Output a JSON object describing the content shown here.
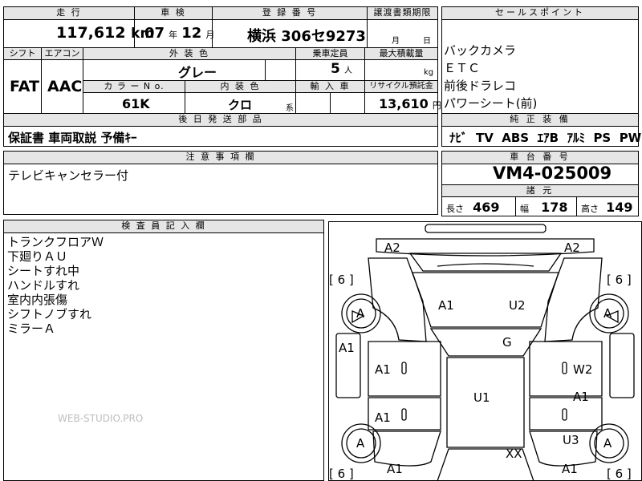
{
  "top": {
    "headers": {
      "mileage": "走 行",
      "inspection": "車 検",
      "registration": "登 録 番 号",
      "transfer": "譲渡書類期限",
      "shift": "シフト",
      "ac": "エアコン",
      "exterior": "外 装 色",
      "capacity": "乗車定員",
      "max_load": "最大積載量",
      "color_no": "カ ラ ー N o.",
      "interior": "内 装 色",
      "import": "輸 入 車",
      "recycle": "リサイクル預託金"
    },
    "mileage_value": "117,612",
    "mileage_unit": "km",
    "inspection_year": "07",
    "year_unit": "年",
    "inspection_month": "12",
    "month_unit": "月",
    "registration_value": "横浜 306セ9273",
    "transfer_month_unit": "月",
    "transfer_day_unit": "日",
    "shift_value": "FAT",
    "ac_value": "AAC",
    "exterior_value": "グレー",
    "capacity_value": "5",
    "capacity_unit": "人",
    "load_unit": "kg",
    "color_no_value": "61K",
    "interior_value": "クロ",
    "interior_suffix": "系",
    "recycle_value": "13,610",
    "recycle_unit": "円"
  },
  "sales_points": {
    "header": "セールスポイント",
    "items": [
      "バックカメラ",
      "ＥＴＣ",
      "前後ドラレコ",
      "パワーシート(前)"
    ]
  },
  "accessories": {
    "header": "後 日 発 送 部 品",
    "value": "保証書 車両取説 予備ｷｰ"
  },
  "genuine": {
    "header": "純 正 装 備",
    "items": [
      "ﾅﾋﾞ",
      "TV",
      "ABS",
      "ｴｱB",
      "ｱﾙﾐ",
      "PS",
      "PW"
    ]
  },
  "notes": {
    "header": "注 意 事 項 欄",
    "value": "テレビキャンセラー付"
  },
  "chassis": {
    "header": "車 台 番 号",
    "value": "VM4-025009"
  },
  "dimensions": {
    "header": "諸 元",
    "length_label": "長さ",
    "length": "469",
    "width_label": "幅",
    "width": "178",
    "height_label": "高さ",
    "height": "149"
  },
  "inspector": {
    "header": "検 査 員 記 入 欄",
    "lines": [
      "トランクフロアＷ",
      "下廻りＡＵ",
      "シートすれ中",
      "ハンドルすれ",
      "室内内張傷",
      "シフトノブすれ",
      "ミラーＡ"
    ]
  },
  "watermark": "WEB-STUDIO.PRO",
  "diagram": {
    "marks": {
      "a2_left": "A2",
      "a2_right": "A2",
      "tire_fl": "[ 6 ]",
      "tire_fr": "[ 6 ]",
      "tire_rl": "[ 6 ]",
      "tire_rr": "[ 6 ]",
      "wheel_fl": "A",
      "wheel_fr": "A",
      "wheel_rl": "A",
      "wheel_rr": "A",
      "hood_left": "A1",
      "hood_right": "U2",
      "windshield": "G",
      "fender_left": "A1",
      "door_fl": "A1",
      "door_fr": "W2",
      "roof": "U1",
      "door_rl": "A1",
      "door_rr": "A1",
      "quarter_right": "U3",
      "trunk": "XX",
      "rear_left": "A1",
      "rear_right": "A1"
    }
  }
}
